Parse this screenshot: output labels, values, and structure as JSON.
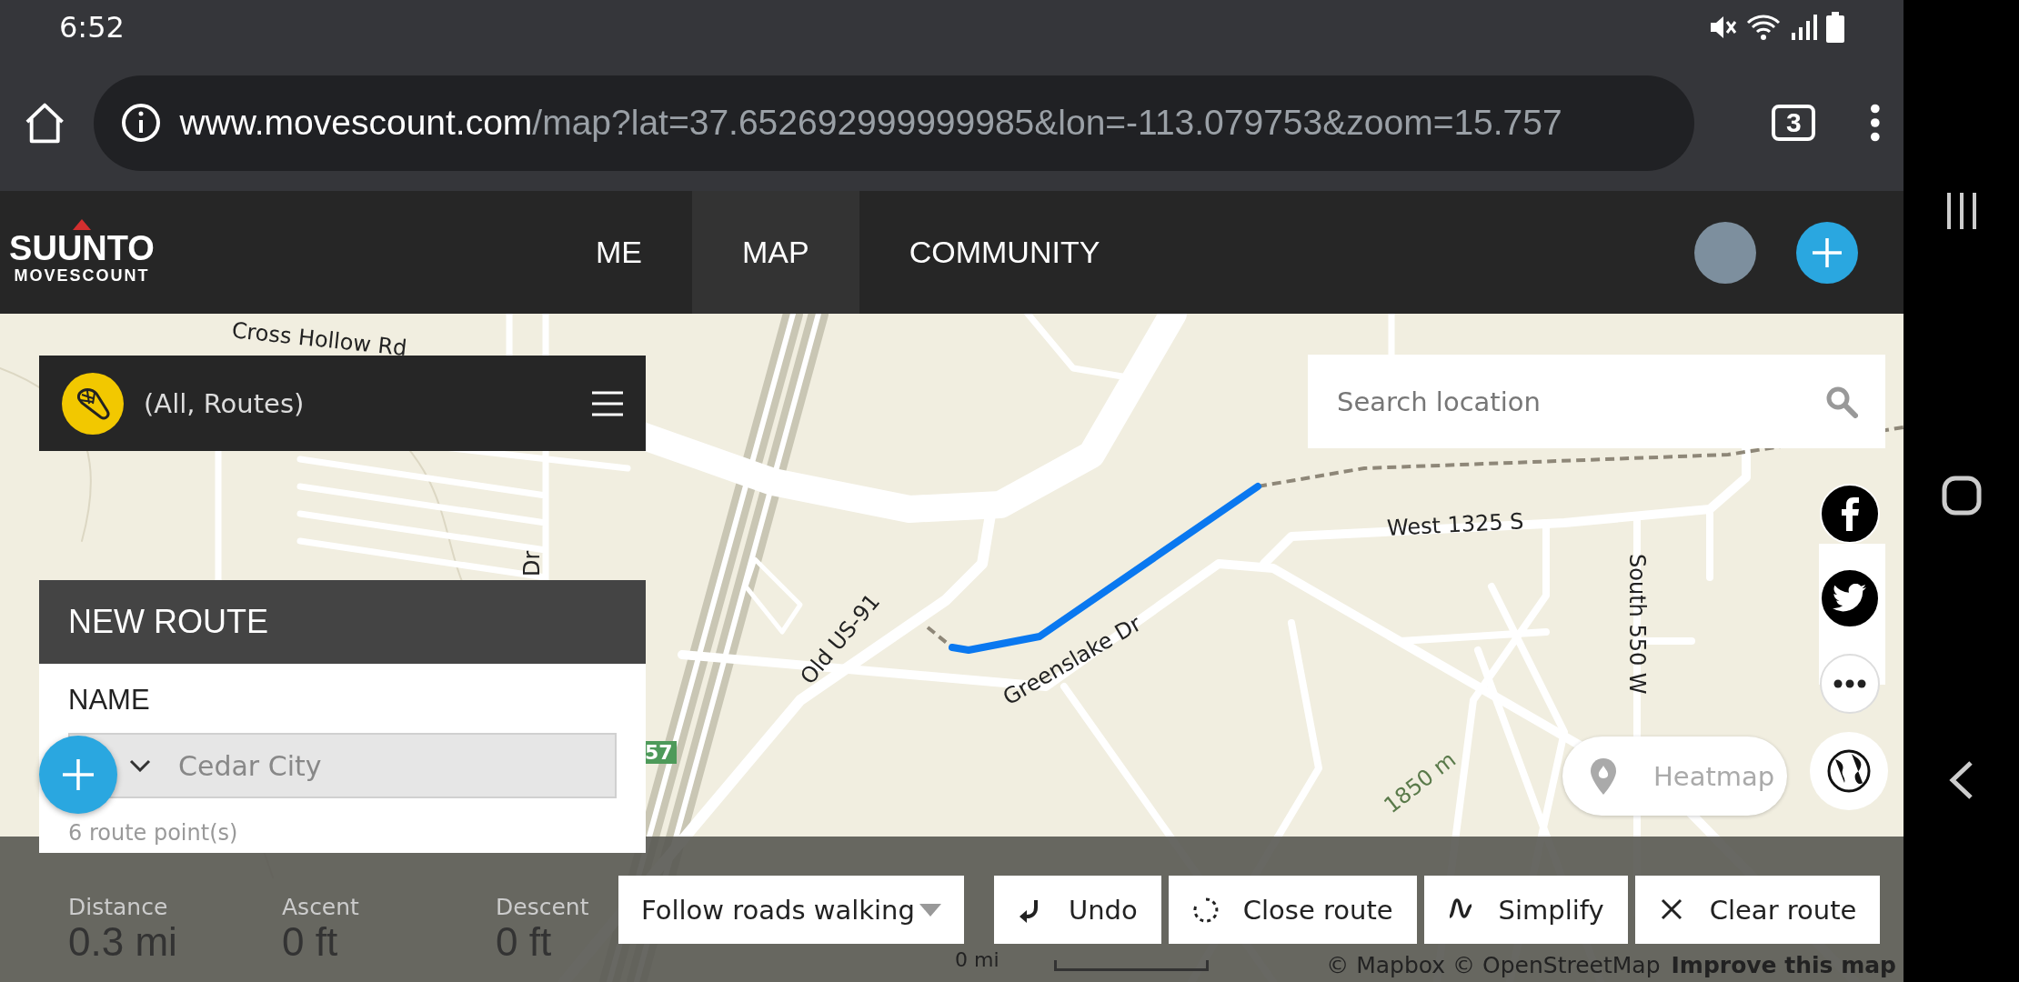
{
  "status_bar": {
    "time": "6:52"
  },
  "browser": {
    "url_host": "www.movescount.com",
    "url_path": "/map?lat=37.652692999999985&lon=-113.079753&zoom=15.757",
    "tab_count": "3"
  },
  "site_header": {
    "brand": "SUUNTO",
    "sub_brand": "MOVESCOUNT",
    "nav": [
      {
        "label": "ME",
        "selected": false
      },
      {
        "label": "MAP",
        "selected": true
      },
      {
        "label": "COMMUNITY",
        "selected": false
      }
    ]
  },
  "map": {
    "labels": [
      {
        "text": "Cross Hollow Rd",
        "kind": "road"
      },
      {
        "text": "Dr",
        "kind": "road"
      },
      {
        "text": "Old US-91",
        "kind": "road"
      },
      {
        "text": "Greenslake Dr",
        "kind": "road"
      },
      {
        "text": "West 1325 S",
        "kind": "road"
      },
      {
        "text": "South 550 W",
        "kind": "road"
      },
      {
        "text": "1850 m",
        "kind": "contour"
      },
      {
        "text": "57",
        "kind": "shield"
      }
    ],
    "scale_label": "0 mi",
    "attribution": "© Mapbox © OpenStreetMap",
    "improve_link": "Improve this map"
  },
  "filter": {
    "label": "(All, Routes)"
  },
  "search": {
    "placeholder": "Search location"
  },
  "new_route": {
    "title": "NEW ROUTE",
    "name_label": "NAME",
    "name_value": "Cedar City",
    "route_points": "6  route point(s)"
  },
  "heatmap": {
    "label": "Heatmap"
  },
  "stats": [
    {
      "label": "Distance",
      "value": "0.3 mi"
    },
    {
      "label": "Ascent",
      "value": "0 ft"
    },
    {
      "label": "Descent",
      "value": "0 ft"
    }
  ],
  "routing": {
    "value": "Follow roads walking"
  },
  "actions": [
    {
      "kind": "undo",
      "label": "Undo"
    },
    {
      "kind": "close",
      "label": "Close route"
    },
    {
      "kind": "simplify",
      "label": "Simplify"
    },
    {
      "kind": "clear",
      "label": "Clear route"
    }
  ]
}
